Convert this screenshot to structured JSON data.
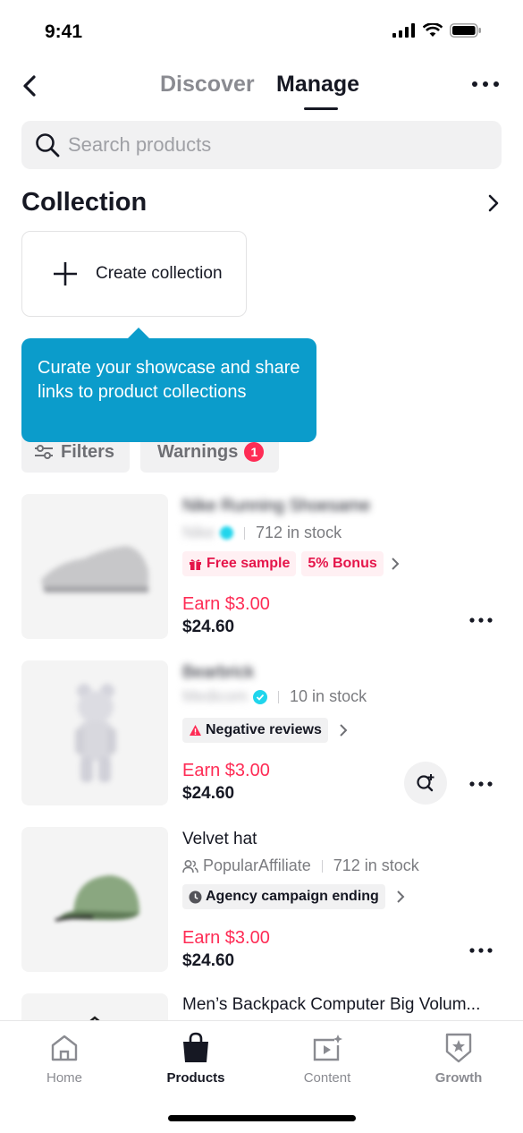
{
  "status": {
    "time": "9:41"
  },
  "nav": {
    "tabs": [
      "Discover",
      "Manage"
    ],
    "active": "Manage"
  },
  "search": {
    "placeholder": "Search products",
    "value": ""
  },
  "collection": {
    "title": "Collection",
    "create_label": "Create collection"
  },
  "tooltip": {
    "text": "Curate your showcase and share links to product collections"
  },
  "filters": {
    "filters_label": "Filters",
    "warnings_label": "Warnings",
    "warnings_count": "1"
  },
  "products": [
    {
      "name": "Nike Running Shoesame",
      "seller": "Nike",
      "stock": "712 in stock",
      "tags": [
        "Free sample",
        "5% Bonus"
      ],
      "earn": "Earn $3.00",
      "price": "$24.60"
    },
    {
      "name": "Bearbrick",
      "seller": "Medicom",
      "stock": "10 in stock",
      "tags": [
        "Negative reviews"
      ],
      "earn": "Earn $3.00",
      "price": "$24.60"
    },
    {
      "name": "Velvet hat",
      "seller": "PopularAffiliate",
      "stock": "712 in stock",
      "tags": [
        "Agency campaign ending"
      ],
      "earn": "Earn $3.00",
      "price": "$24.60"
    },
    {
      "name": "Men’s Backpack Computer Big Volum..."
    }
  ],
  "bottom_nav": [
    {
      "label": "Home",
      "icon": "home-icon"
    },
    {
      "label": "Products",
      "icon": "shopping-bag-icon"
    },
    {
      "label": "Content",
      "icon": "content-icon"
    },
    {
      "label": "Growth",
      "icon": "growth-badge-icon"
    }
  ],
  "colors": {
    "accent": "#fe2c55",
    "tooltip": "#0b9ccb",
    "text": "#161823",
    "verified": "#20d5ec"
  }
}
